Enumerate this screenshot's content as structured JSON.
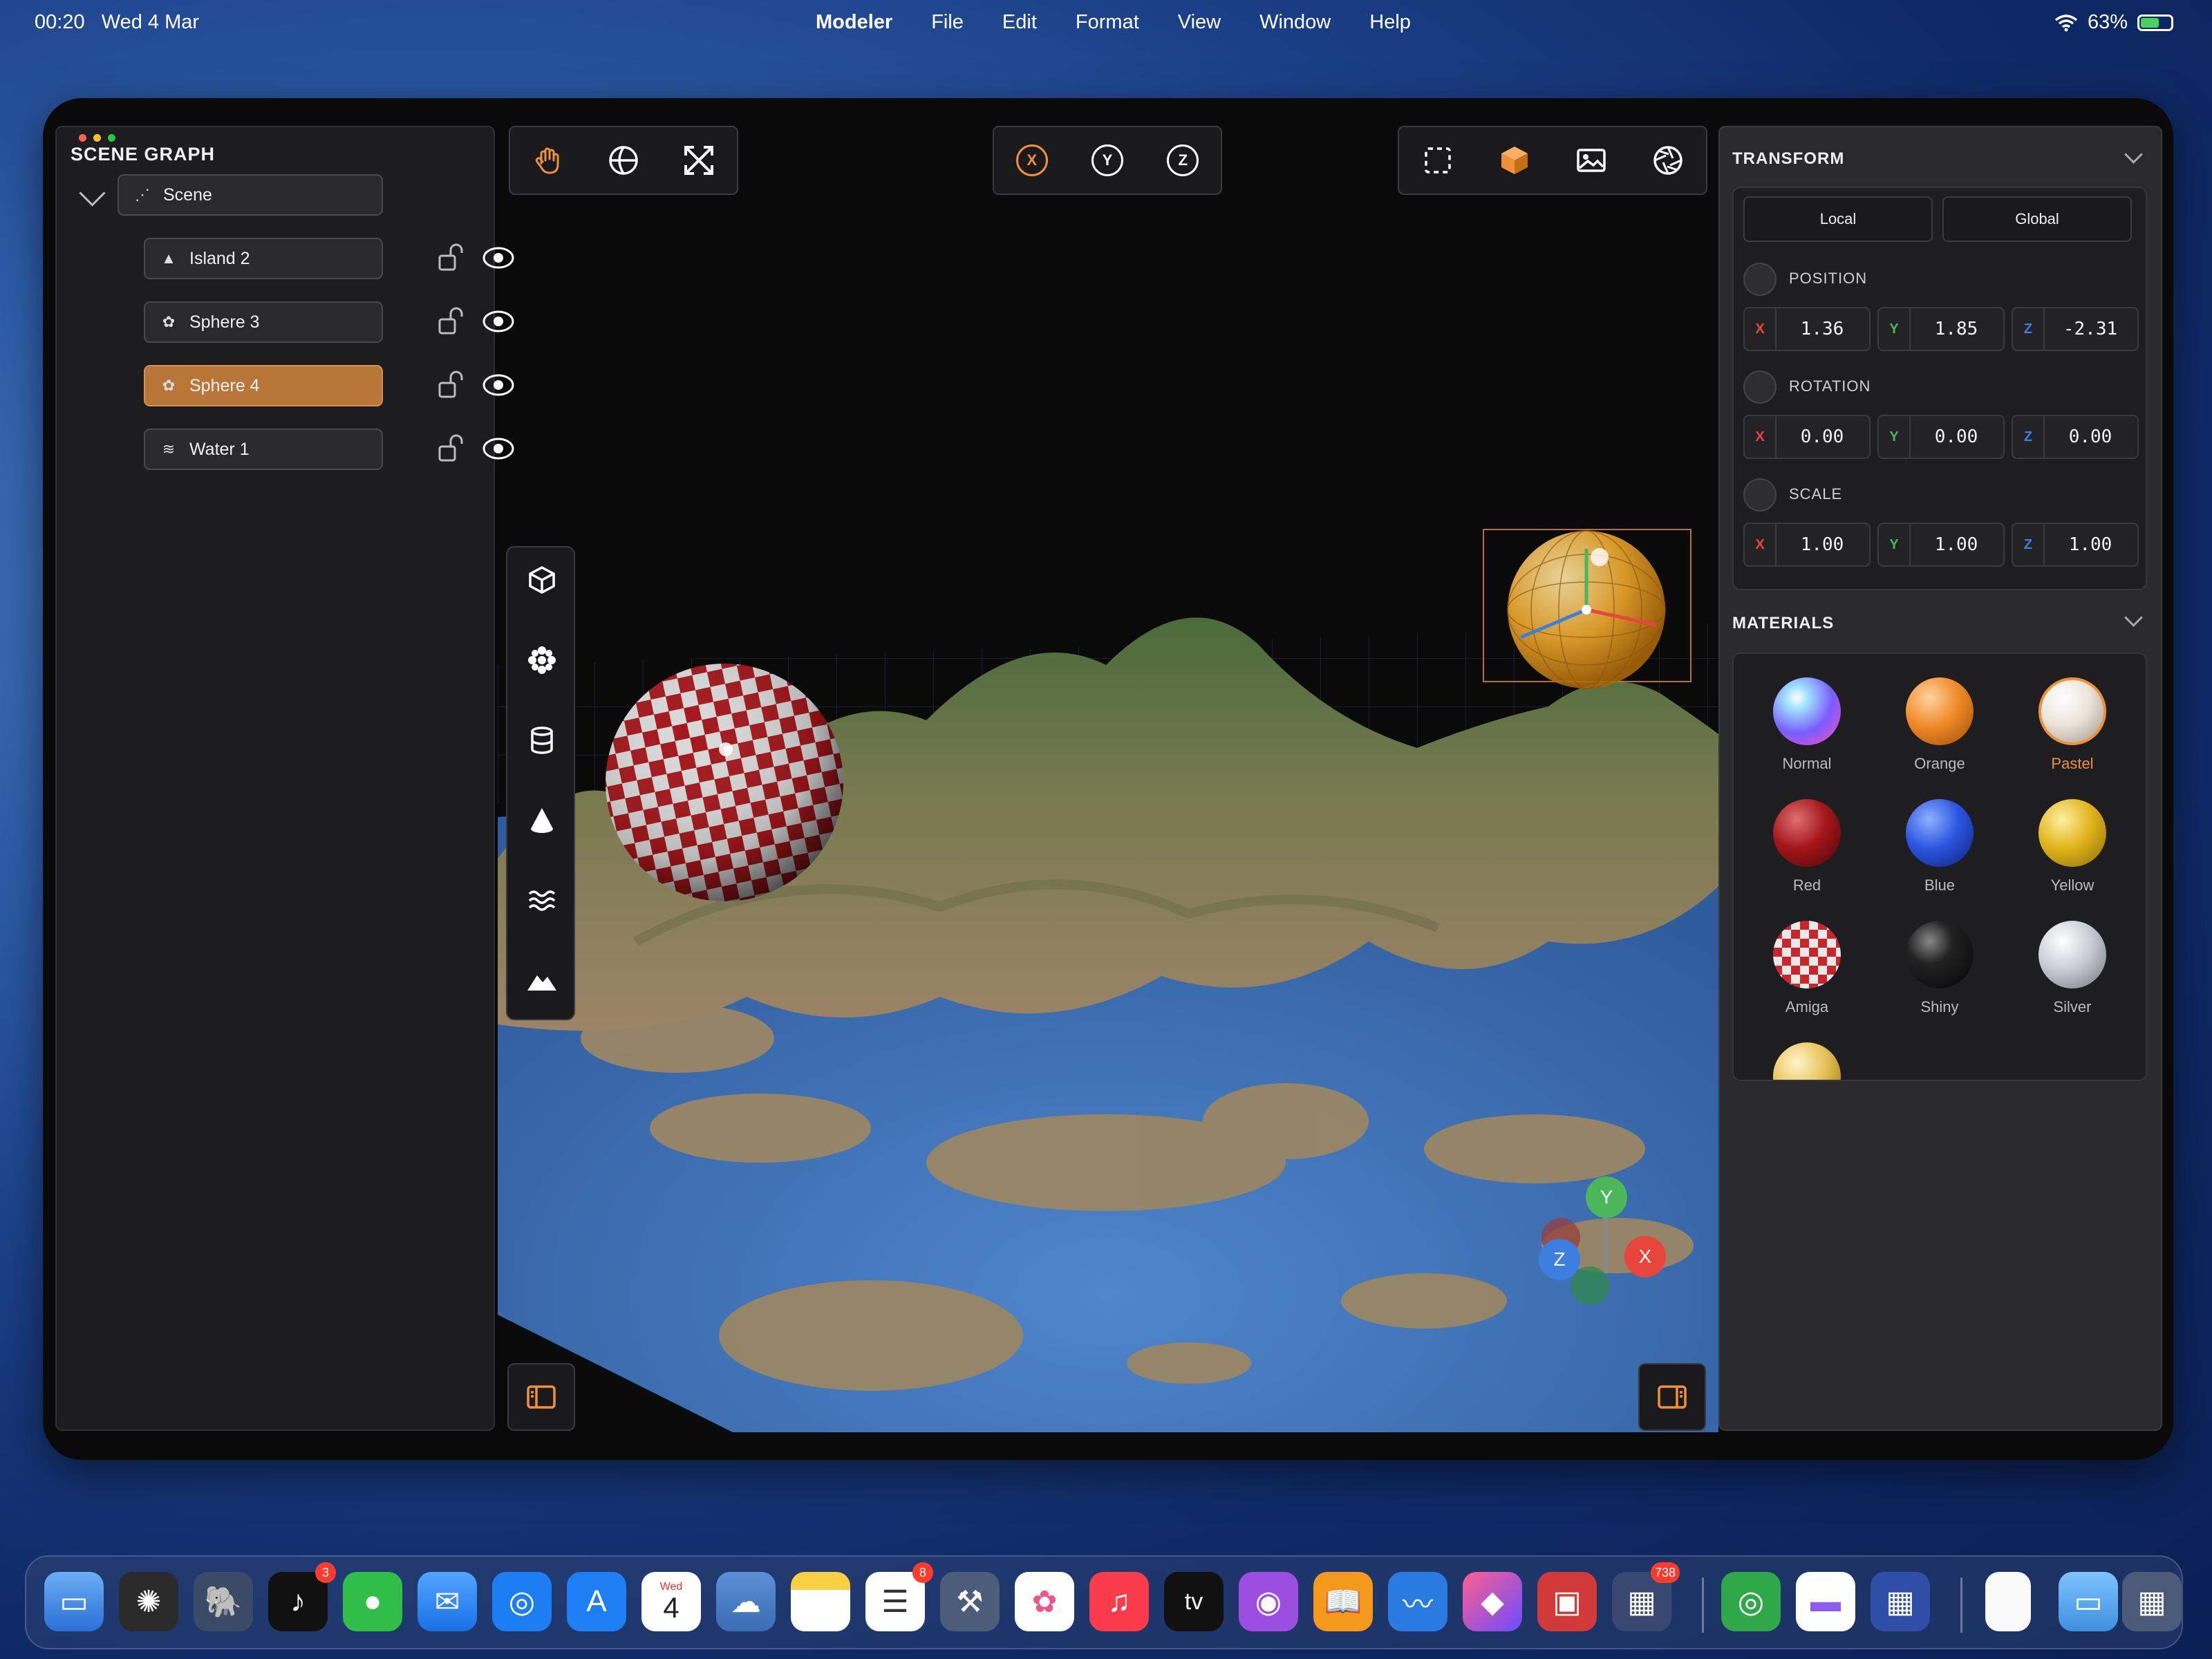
{
  "menubar": {
    "time": "00:20",
    "date": "Wed 4 Mar",
    "app_name": "Modeler",
    "menus": [
      "File",
      "Edit",
      "Format",
      "View",
      "Window",
      "Help"
    ],
    "battery": "63%",
    "battery_level": 0.63
  },
  "scene_graph": {
    "title": "SCENE GRAPH",
    "root": "Scene",
    "nodes": [
      {
        "label": "Island 2",
        "icon": "mountain-icon",
        "selected": false
      },
      {
        "label": "Sphere 3",
        "icon": "sphere-icon",
        "selected": false
      },
      {
        "label": "Sphere 4",
        "icon": "sphere-icon",
        "selected": true
      },
      {
        "label": "Water 1",
        "icon": "water-icon",
        "selected": false
      }
    ]
  },
  "toolbars": {
    "left": [
      "hand-icon",
      "globe-icon",
      "arrows-expand-icon"
    ],
    "axes": [
      "X",
      "Y",
      "Z"
    ],
    "right": [
      "select-rect-icon",
      "cube-filled-icon",
      "image-icon",
      "aperture-icon"
    ],
    "vertical": [
      "cube-icon",
      "sphere-icon",
      "cylinder-icon",
      "cone-icon",
      "water-icon",
      "mountain-icon"
    ]
  },
  "gizmo": {
    "y": "Y",
    "z": "Z",
    "x": "X"
  },
  "transform": {
    "title": "TRANSFORM",
    "local": "Local",
    "global": "Global",
    "position": {
      "label": "POSITION",
      "x": "1.36",
      "y": "1.85",
      "z": "-2.31"
    },
    "rotation": {
      "label": "ROTATION",
      "x": "0.00",
      "y": "0.00",
      "z": "0.00"
    },
    "scale": {
      "label": "SCALE",
      "x": "1.00",
      "y": "1.00",
      "z": "1.00"
    },
    "axis_labels": {
      "x": "X",
      "y": "Y",
      "z": "Z"
    }
  },
  "materials": {
    "title": "MATERIALS",
    "selected": "Pastel",
    "items": [
      "Normal",
      "Orange",
      "Pastel",
      "Red",
      "Blue",
      "Yellow",
      "Amiga",
      "Shiny",
      "Silver"
    ]
  },
  "dock": {
    "badges": {
      "tiktok": "3",
      "reminders": "8",
      "folder": "738"
    },
    "calendar": {
      "day": "Wed",
      "date": "4"
    },
    "tv_label": "tv"
  },
  "colors": {
    "accent": "#f0913a",
    "selected_node": "#b87638",
    "axis_x": "#e8453c",
    "axis_y": "#4ab85a",
    "axis_z": "#3d7fe0"
  }
}
